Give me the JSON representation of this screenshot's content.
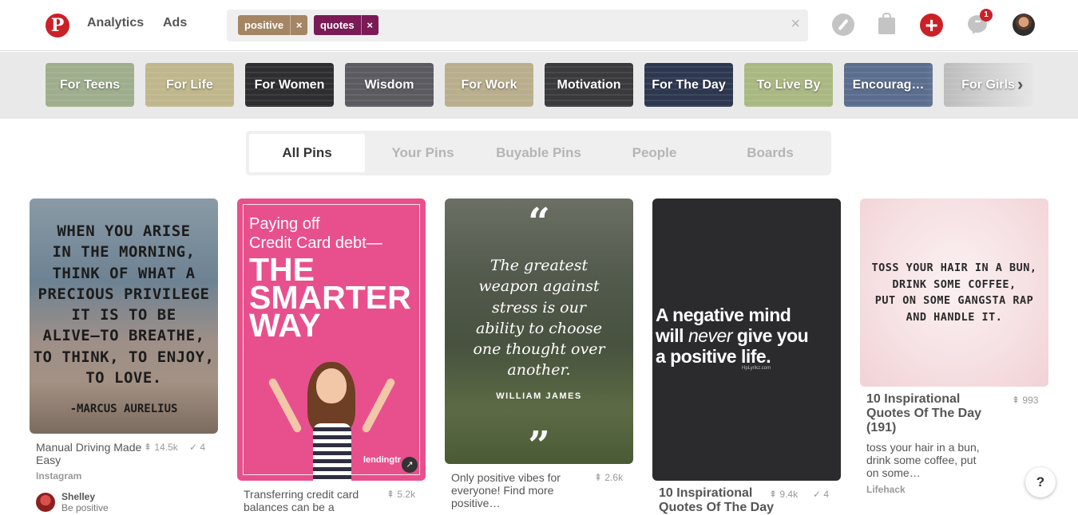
{
  "header": {
    "nav": [
      "Analytics",
      "Ads"
    ],
    "search_tokens": [
      {
        "label": "positive",
        "color": "#a48564"
      },
      {
        "label": "quotes",
        "color": "#7a1b56"
      }
    ],
    "token_remove": "×",
    "clear": "×",
    "notification_count": "1",
    "add_symbol": "+"
  },
  "guides": [
    {
      "label": "For Teens",
      "bg": "#9eae8c"
    },
    {
      "label": "For Life",
      "bg": "#bfb68c"
    },
    {
      "label": "For Women",
      "bg": "#2e2e30"
    },
    {
      "label": "Wisdom",
      "bg": "#5a5a60"
    },
    {
      "label": "For Work",
      "bg": "#b9ae8c"
    },
    {
      "label": "Motivation",
      "bg": "#3a3a3c"
    },
    {
      "label": "For The Day",
      "bg": "#2d3850"
    },
    {
      "label": "To Live By",
      "bg": "#a9b882"
    },
    {
      "label": "Encourag…",
      "bg": "#5b6d8e"
    },
    {
      "label": "For Girls",
      "bg": "#b3b3b3"
    }
  ],
  "guides_next": "›",
  "tabs": [
    "All Pins",
    "Your Pins",
    "Buyable Pins",
    "People",
    "Boards"
  ],
  "pins": {
    "p1": {
      "image_text": [
        "WHEN YOU ARISE",
        "IN THE MORNING,",
        "THINK OF WHAT A",
        "PRECIOUS PRIVILEGE",
        "IT IS TO BE",
        "ALIVE–TO BREATHE,",
        "TO THINK, TO ENJOY,",
        "TO LOVE."
      ],
      "image_attr": "-MARCUS AURELIUS",
      "caption_1": "Manual Driving Made",
      "caption_2": "Easy",
      "repins": "14.5k",
      "likes": "4",
      "source": "Instagram",
      "user": "Shelley",
      "user_board": "Be positive"
    },
    "p2": {
      "image_line1": "Paying off",
      "image_line2": "Credit Card debt—",
      "image_big": [
        "THE",
        "SMARTER",
        "WAY"
      ],
      "image_logo": "lendingtr",
      "ext_icon": "↗",
      "caption_1": "Transferring credit card",
      "caption_2": "balances can be a",
      "repins": "5.2k"
    },
    "p3": {
      "quote_open": "“",
      "quote_close": "”",
      "image_text": [
        "The greatest",
        "weapon against",
        "stress is our",
        "ability to choose",
        "one thought over",
        "another."
      ],
      "image_author": "WILLIAM JAMES",
      "caption_1": "Only positive vibes for",
      "caption_2": "everyone! Find more",
      "caption_3": "positive…",
      "repins": "2.6k"
    },
    "p4": {
      "image_l1": "A negative mind",
      "image_l2_a": "will ",
      "image_l2_em": "never",
      "image_l2_b": " give you",
      "image_l3": "a positive life.",
      "image_small": "HpLyrikz.com",
      "title_1": "10 Inspirational",
      "title_2": "Quotes Of The Day",
      "repins": "9.4k",
      "likes": "4"
    },
    "p5": {
      "image_text": [
        "TOSS YOUR HAIR IN A BUN,",
        "DRINK SOME COFFEE,",
        "PUT ON SOME GANGSTA RAP",
        "AND HANDLE IT."
      ],
      "title_1": "10 Inspirational",
      "title_2": "Quotes Of The Day",
      "title_3": "(191)",
      "repins": "993",
      "desc_1": "toss your hair in a bun,",
      "desc_2": "drink some coffee, put",
      "desc_3": "on some…",
      "source": "Lifehack"
    }
  },
  "help": "?"
}
